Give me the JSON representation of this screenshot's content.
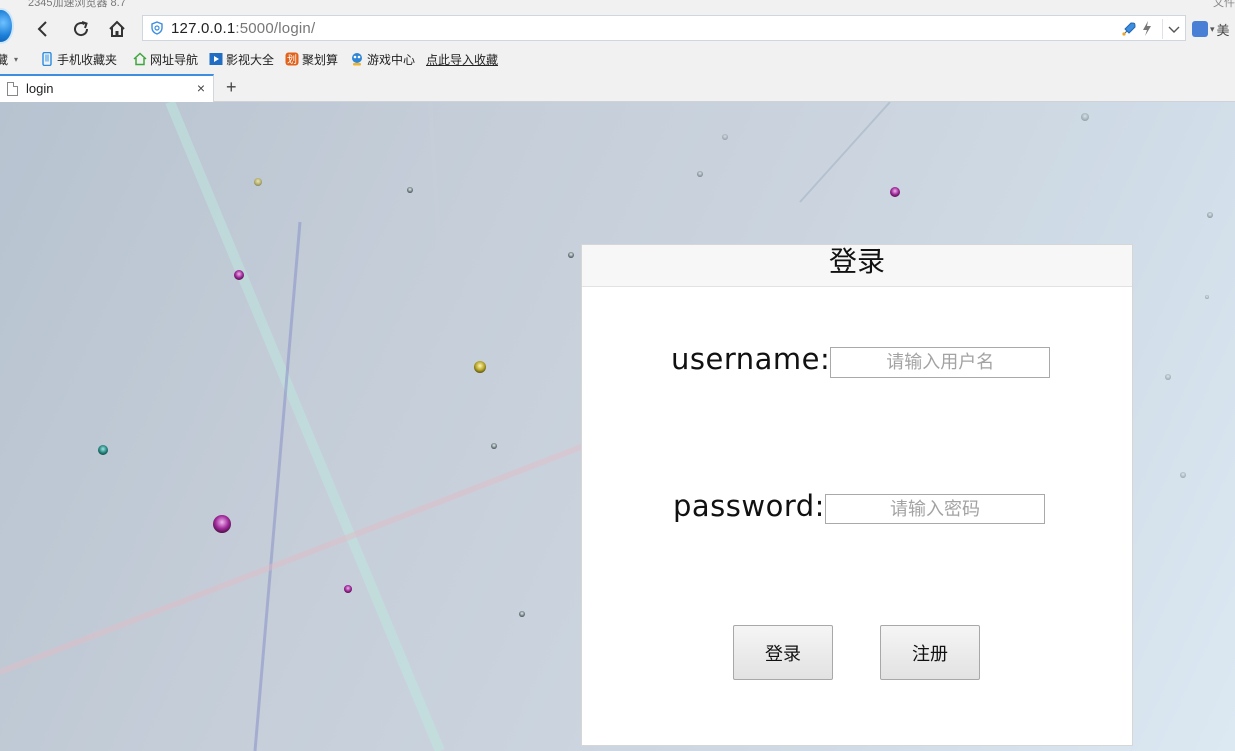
{
  "window": {
    "title": "2345加速浏览器 8.7",
    "top_right": "文件"
  },
  "navbar": {
    "url_host": "127.0.0.1",
    "url_path": ":5000/login/",
    "ext_label": "美"
  },
  "bookmarks": {
    "cut_label": "藏",
    "items": [
      {
        "label": "手机收藏夹",
        "icon": "phone-icon",
        "color": "#2a8be0"
      },
      {
        "label": "网址导航",
        "icon": "home-nav-icon",
        "color": "#3fa63f"
      },
      {
        "label": "影视大全",
        "icon": "film-icon",
        "color": "#1f6ec4"
      },
      {
        "label": "聚划算",
        "icon": "juhuasuan-icon",
        "color": "#e2621b"
      },
      {
        "label": "游戏中心",
        "icon": "game-icon",
        "color": "#2f86d6"
      },
      {
        "label": "点此导入收藏",
        "icon": "",
        "color": ""
      }
    ]
  },
  "tab": {
    "label": "login",
    "close": "×",
    "new_tab": "+"
  },
  "login": {
    "title": "登录",
    "username_label": "username:",
    "username_placeholder": "请输入用户名",
    "password_label": "password:",
    "password_placeholder": "请输入密码",
    "login_button": "登录",
    "register_button": "注册"
  },
  "colors": {
    "accent": "#3d8de0",
    "card_header_bg": "#f7f7f7"
  }
}
